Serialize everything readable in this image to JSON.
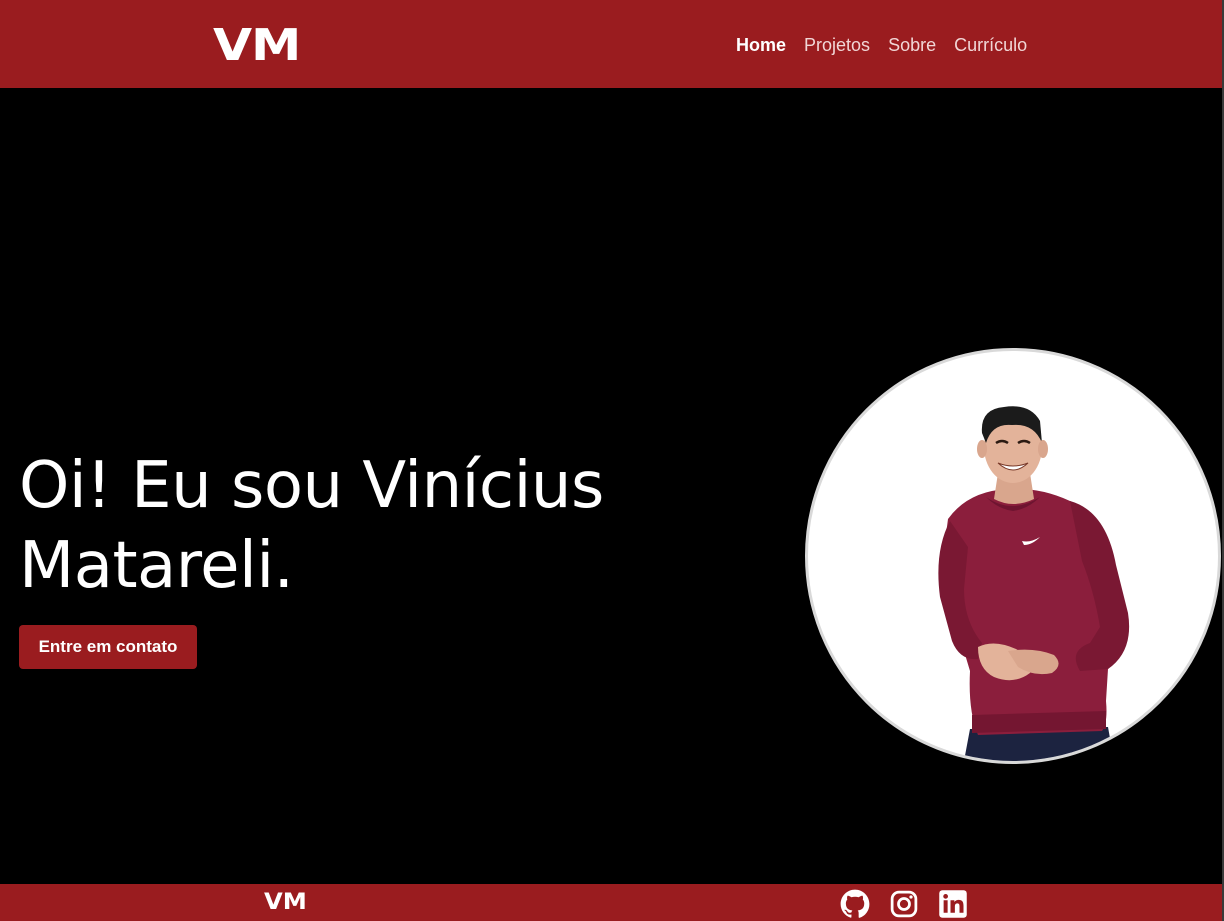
{
  "header": {
    "logo": "VM",
    "nav": [
      {
        "label": "Home",
        "active": true
      },
      {
        "label": "Projetos",
        "active": false
      },
      {
        "label": "Sobre",
        "active": false
      },
      {
        "label": "Currículo",
        "active": false
      }
    ]
  },
  "hero": {
    "title_line1": "Oi! Eu sou Vinícius",
    "title_line2": "Matareli.",
    "cta_label": "Entre em contato",
    "avatar_alt": "profile-photo"
  },
  "footer": {
    "logo": "VM",
    "social": [
      {
        "icon": "github-icon"
      },
      {
        "icon": "instagram-icon"
      },
      {
        "icon": "linkedin-icon"
      }
    ]
  },
  "colors": {
    "brand_red": "#9a1c1f",
    "background": "#000000",
    "text": "#ffffff"
  }
}
